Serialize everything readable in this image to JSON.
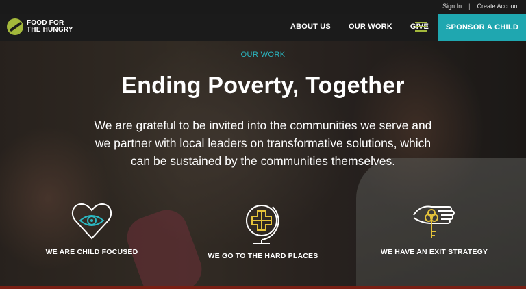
{
  "utility": {
    "sign_in": "Sign In",
    "separator": "|",
    "create_account": "Create Account"
  },
  "brand": {
    "line1": "FOOD FOR",
    "line2": "THE HUNGRY",
    "logo_color": "#a3b83b"
  },
  "nav": {
    "items": [
      "ABOUT US",
      "OUR WORK",
      "GIVE"
    ],
    "menu_icon": "hamburger-icon",
    "cta": "SPONSOR A CHILD",
    "cta_color": "#1fa7b0"
  },
  "hero": {
    "eyebrow": "OUR WORK",
    "title": "Ending Poverty, Together",
    "body": "We are grateful to be invited into the communities we serve and we partner with local leaders on transformative solutions, which can be sustained by the communities themselves."
  },
  "pillars": [
    {
      "icon": "heart-eye-icon",
      "label": "WE ARE CHILD FOCUSED"
    },
    {
      "icon": "globe-icon",
      "label": "WE GO TO THE HARD PLACES"
    },
    {
      "icon": "hand-key-icon",
      "label": "WE HAVE AN EXIT STRATEGY"
    }
  ],
  "accent_colors": {
    "teal": "#2bb8c2",
    "yellow": "#e5c33a",
    "green": "#a3b83b"
  }
}
